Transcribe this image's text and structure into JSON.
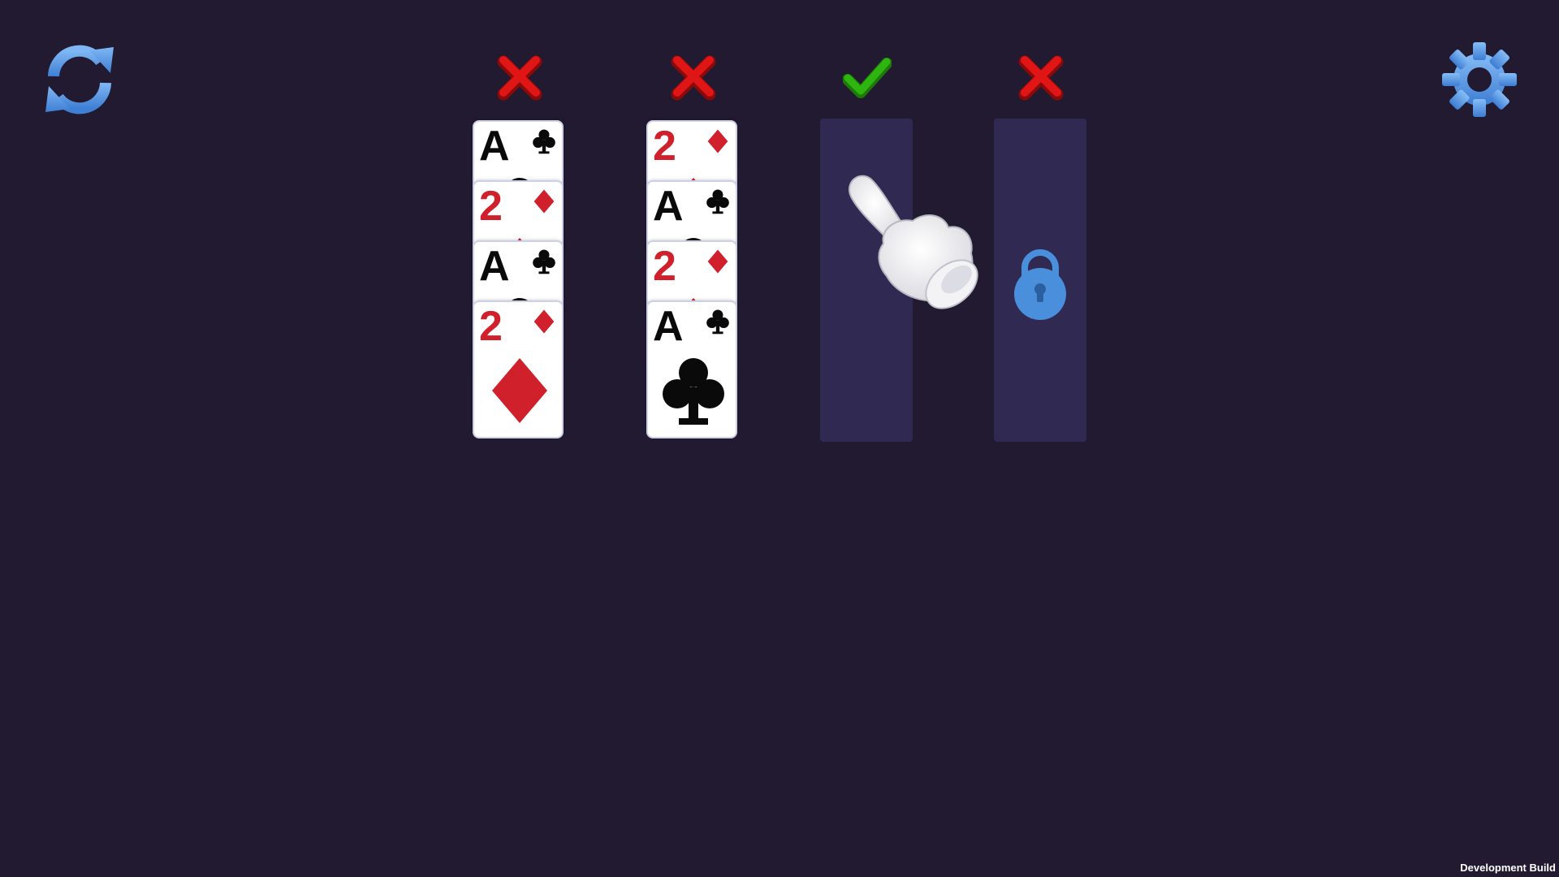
{
  "controls": {
    "restart_icon": "refresh-icon",
    "settings_icon": "gear-icon",
    "icon_color": "#5b9be8"
  },
  "columns": [
    {
      "status": "invalid",
      "status_icon": "red-x-icon",
      "locked": false,
      "cards": [
        {
          "rank": "A",
          "suit": "clubs",
          "color": "black"
        },
        {
          "rank": "2",
          "suit": "diamonds",
          "color": "red"
        },
        {
          "rank": "A",
          "suit": "clubs",
          "color": "black"
        },
        {
          "rank": "2",
          "suit": "diamonds",
          "color": "red"
        }
      ]
    },
    {
      "status": "invalid",
      "status_icon": "red-x-icon",
      "locked": false,
      "cards": [
        {
          "rank": "2",
          "suit": "diamonds",
          "color": "red"
        },
        {
          "rank": "A",
          "suit": "clubs",
          "color": "black"
        },
        {
          "rank": "2",
          "suit": "diamonds",
          "color": "red"
        },
        {
          "rank": "A",
          "suit": "clubs",
          "color": "black"
        }
      ]
    },
    {
      "status": "valid",
      "status_icon": "green-check-icon",
      "locked": false,
      "cards": []
    },
    {
      "status": "invalid",
      "status_icon": "red-x-icon",
      "locked": true,
      "cards": []
    }
  ],
  "tutorial_hint": {
    "icon": "pointing-hand-icon",
    "target_column": 3
  },
  "colors": {
    "background": "#211a30",
    "slot": "#302a52",
    "red_suit": "#d0202c",
    "black_suit": "#0a0a0a",
    "check_green": "#2fb510",
    "x_red": "#e01515",
    "lock_blue": "#4a8fdb"
  },
  "footer": {
    "build_label": "Development Build"
  }
}
